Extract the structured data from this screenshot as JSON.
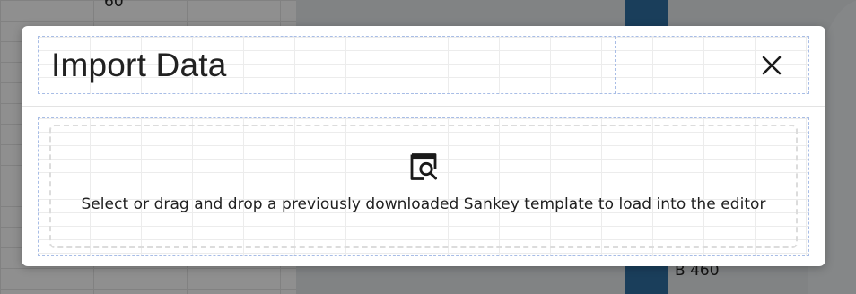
{
  "background": {
    "axis_tick": "60",
    "node_label": "B 460"
  },
  "modal": {
    "title": "Import Data",
    "close_icon": "close-icon",
    "drop_zone": {
      "icon": "file-search-icon",
      "instructions": "Select or drag and drop a previously downloaded Sankey template to load into the editor"
    }
  },
  "colors": {
    "overlay": "rgba(0,0,0,0.44)",
    "modal_bg": "#ffffff",
    "guide_border": "#a8bde6",
    "drop_border": "#dcdcdc",
    "text": "#212121",
    "background_bar": "#2f6fa3"
  }
}
